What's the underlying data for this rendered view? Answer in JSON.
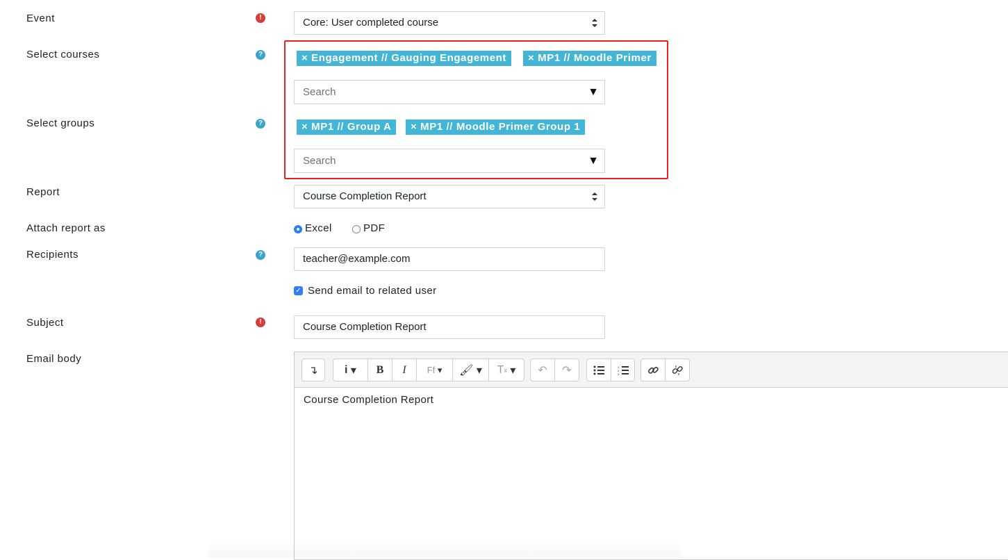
{
  "form": {
    "event": {
      "label": "Event",
      "value": "Core: User completed course"
    },
    "courses": {
      "label": "Select courses",
      "tags": [
        "× Engagement // Gauging Engagement",
        "× MP1 // Moodle Primer"
      ],
      "search_placeholder": "Search"
    },
    "groups": {
      "label": "Select groups",
      "tags": [
        "× MP1 // Group A",
        "× MP1 // Moodle Primer Group 1"
      ],
      "search_placeholder": "Search"
    },
    "report": {
      "label": "Report",
      "value": "Course Completion Report"
    },
    "attach": {
      "label": "Attach report as",
      "options": [
        "Excel",
        "PDF"
      ],
      "selected": "Excel"
    },
    "recipients": {
      "label": "Recipients",
      "value": "teacher@example.com"
    },
    "send_related": {
      "label": "Send email to related user",
      "checked": true
    },
    "subject": {
      "label": "Subject",
      "value": "Course Completion Report"
    },
    "email_body": {
      "label": "Email body",
      "content": "Course Completion Report"
    }
  },
  "icons": {
    "info": "question-circle-icon",
    "required": "exclamation-circle-icon"
  },
  "toolbar": {
    "buttons": [
      "↴",
      "i ▾",
      "B",
      "I",
      "Ff ▾",
      "🖌 ▾",
      "Tx ▾",
      "↶",
      "↷",
      "list",
      "ordered-list",
      "link",
      "unlink"
    ]
  },
  "colors": {
    "tag": "#43b5d5",
    "info": "#3aa5c9",
    "required": "#d43f3a",
    "highlight": "#e8231b",
    "accent": "#2d7ef7"
  }
}
